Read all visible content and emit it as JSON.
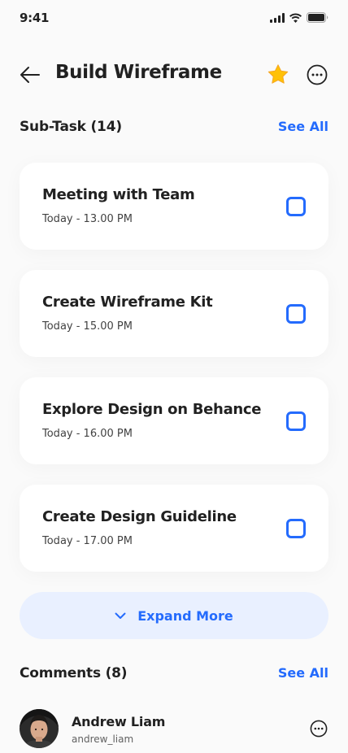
{
  "status_bar": {
    "time": "9:41",
    "icons": [
      "signal-icon",
      "wifi-icon",
      "battery-icon"
    ]
  },
  "header": {
    "title": "Build Wireframe",
    "back_icon": "arrow-left-icon",
    "star_icon": "star-icon",
    "more_icon": "more-circle-icon"
  },
  "subtasks": {
    "title": "Sub-Task (14)",
    "see_all": "See All",
    "items": [
      {
        "title": "Meeting with Team",
        "time": "Today - 13.00 PM",
        "done": true
      },
      {
        "title": "Create Wireframe Kit",
        "time": "Today - 15.00 PM",
        "done": false
      },
      {
        "title": "Explore Design on Behance",
        "time": "Today - 16.00 PM",
        "done": false
      },
      {
        "title": "Create Design Guideline",
        "time": "Today - 17.00 PM",
        "done": false
      }
    ],
    "expand_label": "Expand More"
  },
  "comments": {
    "title": "Comments (8)",
    "see_all": "See All",
    "items": [
      {
        "name": "Andrew Liam",
        "username": "andrew_liam"
      }
    ]
  },
  "colors": {
    "primary": "#246BFD",
    "primary_light": "#E9F0FF",
    "star": "#FFC107",
    "text": "#212121",
    "background": "#FAFAFA"
  }
}
